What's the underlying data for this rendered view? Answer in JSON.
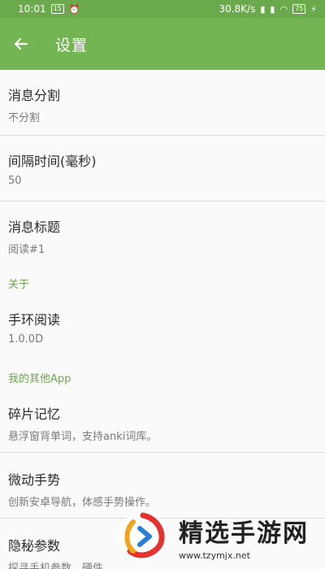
{
  "status": {
    "time": "10:01",
    "badge": "15",
    "speed": "30.8K/s",
    "battery": "75"
  },
  "appbar": {
    "title": "设置"
  },
  "items": [
    {
      "primary": "消息分割",
      "secondary": "不分割"
    },
    {
      "primary": "间隔时间(毫秒)",
      "secondary": "50"
    },
    {
      "primary": "消息标题",
      "secondary": "阅读#1"
    }
  ],
  "about": {
    "section": "关于",
    "app_name": "手环阅读",
    "version": "1.0.0D"
  },
  "other_apps": {
    "section": "我的其他App",
    "apps": [
      {
        "name": "碎片记忆",
        "desc": "悬浮窗背单词，支持anki词库。"
      },
      {
        "name": "微动手势",
        "desc": "创新安卓导航，体感手势操作。"
      },
      {
        "name": "隐秘参数",
        "desc": "探寻手机参数，硬件..."
      }
    ]
  },
  "watermark": {
    "title": "精选手游网",
    "url": "www.tzymjx.net"
  },
  "colors": {
    "primary": "#73b553",
    "accent": "#6aaa4d"
  }
}
